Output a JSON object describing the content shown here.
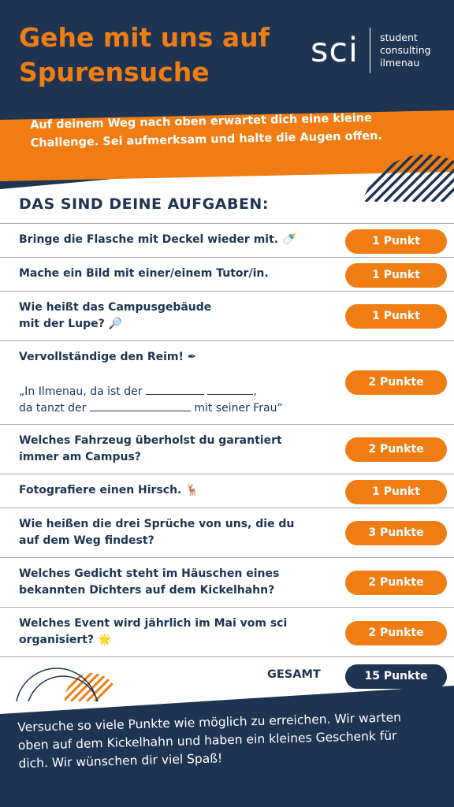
{
  "header": {
    "title": "Gehe mit uns auf Spurensuche",
    "logo_mark": "sci",
    "logo_line1": "student",
    "logo_line2": "consulting",
    "logo_line3": "ilmenau"
  },
  "banner": {
    "text": "Auf deinem Weg nach oben erwartet dich eine kleine Challenge. Sei aufmerksam und halte die Augen offen."
  },
  "section_title": "DAS SIND DEINE AUFGABEN:",
  "tasks": [
    {
      "text": "Bringe die Flasche mit Deckel wieder mit.",
      "emoji": "🍼",
      "points": "1 Punkt"
    },
    {
      "text": "Mache ein Bild mit einer/einem Tutor/in.",
      "points": "1 Punkt"
    },
    {
      "line1": "Wie heißt das Campusgebäude",
      "line2": "mit der Lupe?",
      "emoji": "🔎",
      "points": "1 Punkt"
    },
    {
      "text": "Vervollständige den Reim!",
      "emoji": "✒",
      "poem_line1_a": "„In Ilmenau, da ist der",
      "poem_line1_b": ",",
      "poem_line2_a": "da tanzt der",
      "poem_line2_b": "mit seiner Frau“",
      "points": "2 Punkte"
    },
    {
      "line1": "Welches Fahrzeug überholst du garantiert",
      "line2": "immer am Campus?",
      "points": "2 Punkte"
    },
    {
      "text": "Fotografiere einen Hirsch.",
      "emoji": "🦌",
      "points": "1 Punkt"
    },
    {
      "line1": "Wie heißen die drei Sprüche von uns, die du",
      "line2": "auf dem Weg findest?",
      "points": "3 Punkte"
    },
    {
      "line1": "Welches Gedicht steht im Häuschen eines",
      "line2": "bekannten Dichters auf dem Kickelhahn?",
      "points": "2 Punkte"
    },
    {
      "line1": "Welches Event wird jährlich im Mai vom sci",
      "line2": "organisiert?",
      "emoji": "🌟",
      "points": "2 Punkte"
    }
  ],
  "total": {
    "label": "GESAMT",
    "points": "15 Punkte"
  },
  "footer": {
    "text": "Versuche so viele Punkte wie möglich zu erreichen. Wir warten oben auf dem Kickelhahn und haben ein kleines Geschenk für dich. Wir wünschen dir viel Spaß!"
  },
  "colors": {
    "navy": "#1e3452",
    "orange": "#f07d13",
    "divider": "#a7a9ac"
  }
}
